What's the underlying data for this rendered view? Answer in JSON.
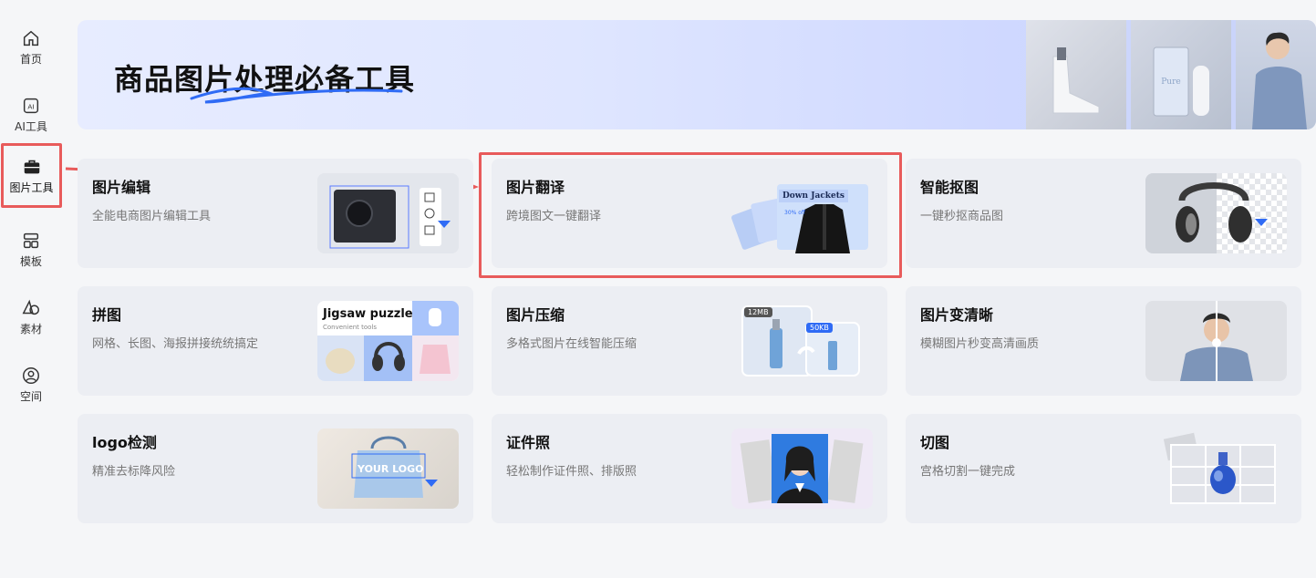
{
  "nav": [
    {
      "label": "首页",
      "icon": "home-icon"
    },
    {
      "label": "AI工具",
      "icon": "ai-icon"
    },
    {
      "label": "图片工具",
      "icon": "toolbox-icon",
      "active": true
    },
    {
      "label": "模板",
      "icon": "template-icon"
    },
    {
      "label": "素材",
      "icon": "material-icon"
    },
    {
      "label": "空间",
      "icon": "user-space-icon"
    }
  ],
  "banner": {
    "title": "商品图片处理必备工具"
  },
  "cards": [
    {
      "title": "图片编辑",
      "desc": "全能电商图片编辑工具"
    },
    {
      "title": "图片翻译",
      "desc": "跨境图文一键翻译",
      "thumb_text": "Down Jackets",
      "thumb_sub": "30% off"
    },
    {
      "title": "智能抠图",
      "desc": "一键秒抠商品图"
    },
    {
      "title": "拼图",
      "desc": "网格、长图、海报拼接统统搞定",
      "thumb_text": "Jigsaw puzzle",
      "thumb_sub": "Convenient tools"
    },
    {
      "title": "图片压缩",
      "desc": "多格式图片在线智能压缩",
      "badge_a": "12MB",
      "badge_b": "50KB"
    },
    {
      "title": "图片变清晰",
      "desc": "模糊图片秒变高清画质"
    },
    {
      "title": "logo检测",
      "desc": "精准去标降风险",
      "thumb_text": "YOUR LOGO"
    },
    {
      "title": "证件照",
      "desc": "轻松制作证件照、排版照"
    },
    {
      "title": "切图",
      "desc": "宫格切割一键完成"
    }
  ],
  "colors": {
    "accent": "#e85b5b",
    "brand_blue": "#2f6bf5"
  }
}
